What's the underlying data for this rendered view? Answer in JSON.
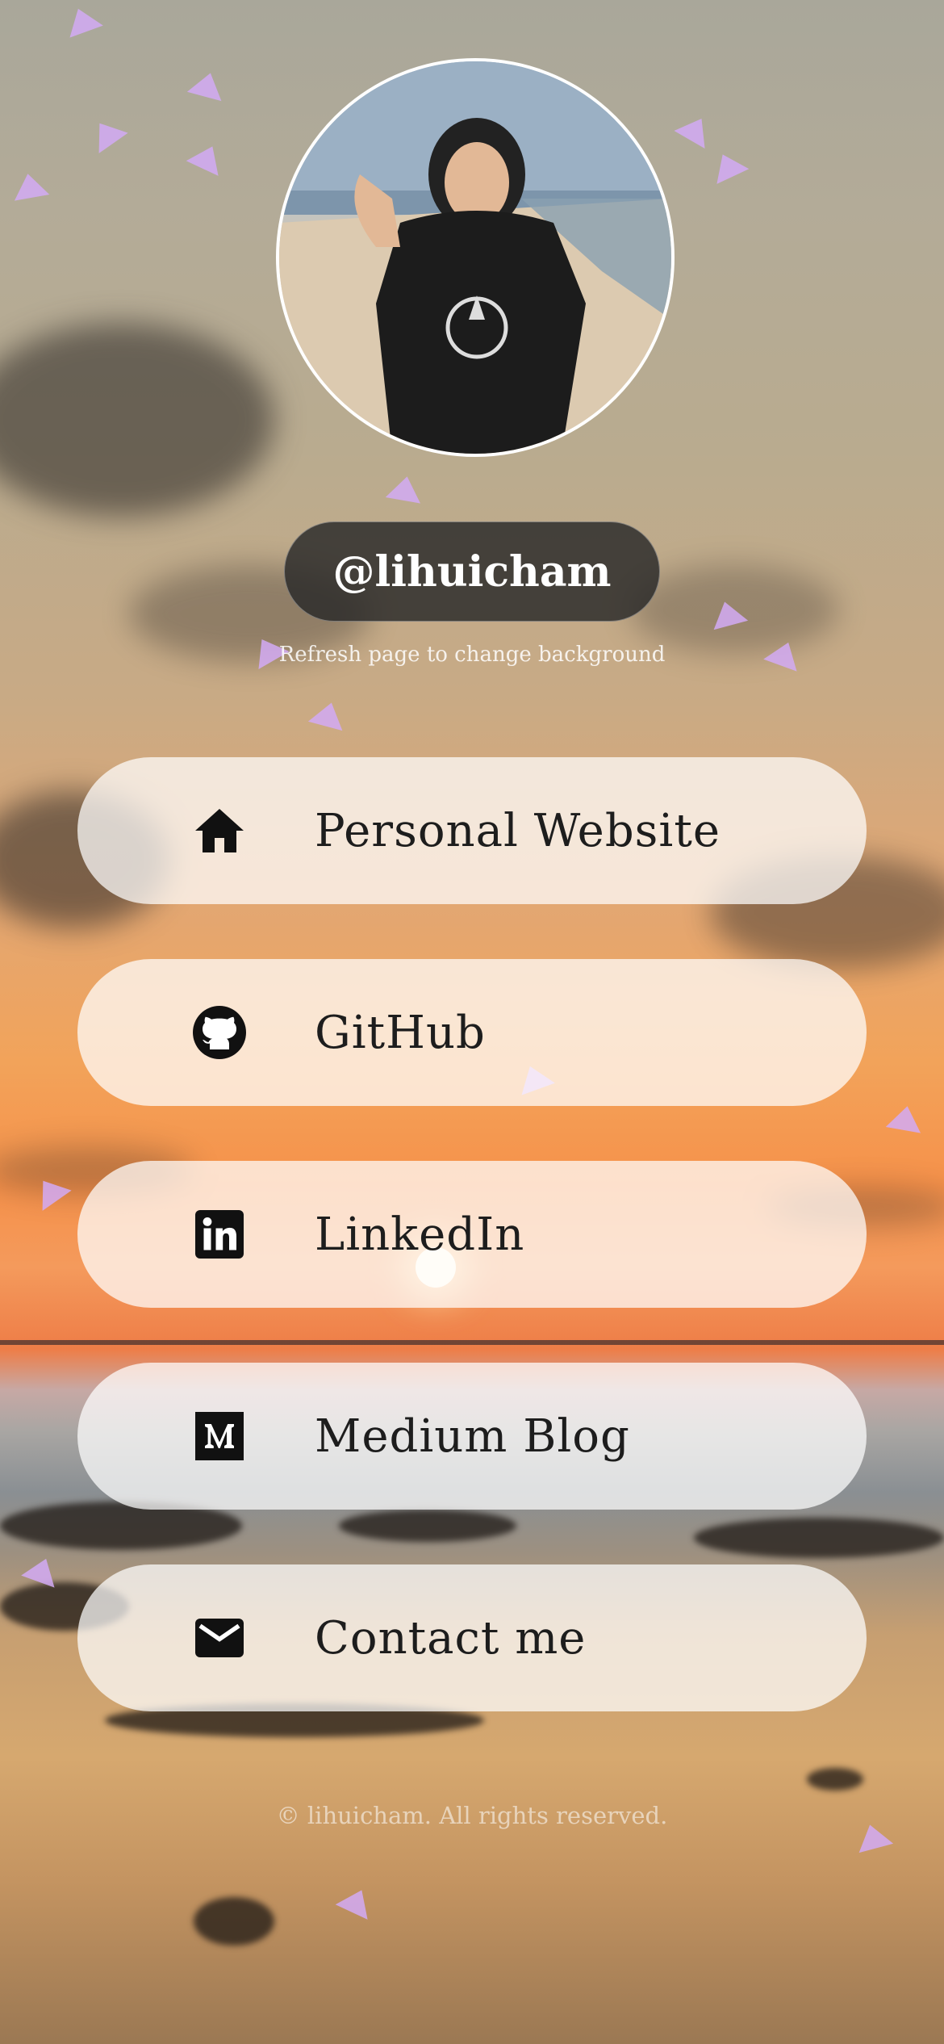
{
  "profile": {
    "handle": "@lihuicham",
    "hint": "Refresh page to change background"
  },
  "links": [
    {
      "label": "Personal Website",
      "icon": "home-icon"
    },
    {
      "label": "GitHub",
      "icon": "github-icon"
    },
    {
      "label": "LinkedIn",
      "icon": "linkedin-icon"
    },
    {
      "label": "Medium Blog",
      "icon": "medium-icon"
    },
    {
      "label": "Contact me",
      "icon": "mail-icon"
    }
  ],
  "footer": {
    "text": "© lihuicham. All rights reserved."
  },
  "colors": {
    "button_bg": "#ffffff",
    "handle_bg": "#282828",
    "text": "#1d1d1d"
  }
}
